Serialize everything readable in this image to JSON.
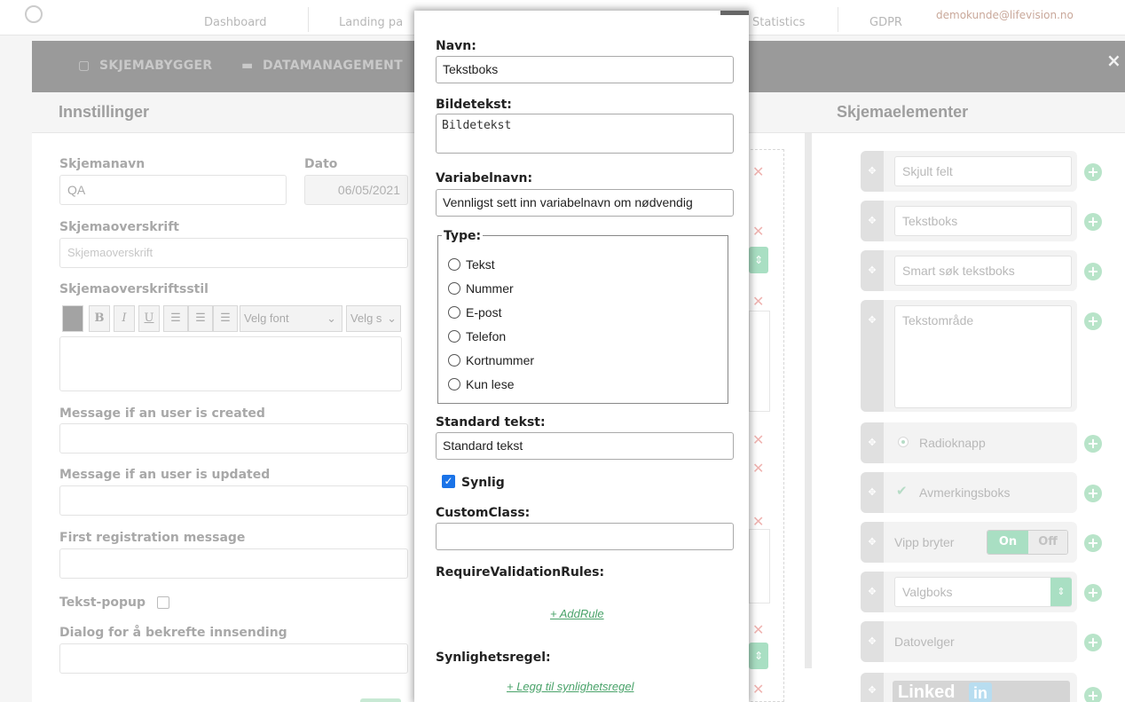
{
  "topnav": {
    "items": [
      "Dashboard",
      "Landing pa",
      "Statistics",
      "GDPR"
    ],
    "email": "demokunde@lifevision.no"
  },
  "modal": {
    "tabs": [
      "SKJEMABYGGER",
      "DATAMANAGEMENT"
    ],
    "close": "×"
  },
  "settings": {
    "title": "Innstillinger",
    "form_name_label": "Skjemanavn",
    "form_name_value": "QA",
    "date_label": "Dato",
    "date_value": "06/05/2021",
    "heading_label": "Skjemaoverskrift",
    "heading_placeholder": "Skjemaoverskrift",
    "heading_style_label": "Skjemaoverskriftsstil",
    "toolbar": {
      "bold": "B",
      "italic": "I",
      "underline": "U",
      "font_select": "Velg font",
      "size_select": "Velg s"
    },
    "msg_created_label": "Message if an user is created",
    "msg_updated_label": "Message if an user is updated",
    "first_reg_label": "First registration message",
    "popup_label": "Tekst-popup",
    "confirm_label": "Dialog for å bekrefte innsending"
  },
  "elements": {
    "title": "Skjemaelementer",
    "items": [
      {
        "label": "Skjult felt"
      },
      {
        "label": "Tekstboks"
      },
      {
        "label": "Smart søk tekstboks"
      },
      {
        "label": "Tekstområde"
      },
      {
        "label": "Radioknapp"
      },
      {
        "label": "Avmerkingsboks"
      },
      {
        "label": "Vipp bryter",
        "on": "On",
        "off": "Off"
      },
      {
        "label": "Valgboks"
      },
      {
        "label": "Datovelger"
      },
      {
        "label": "Linked"
      }
    ]
  },
  "popup": {
    "name_label": "Navn:",
    "name_value": "Tekstboks",
    "caption_label": "Bildetekst:",
    "caption_value": "Bildetekst",
    "varname_label": "Variabelnavn:",
    "varname_value": "Vennligst sett inn variabelnavn om nødvendig",
    "type_legend": "Type:",
    "types": [
      "Tekst",
      "Nummer",
      "E-post",
      "Telefon",
      "Kortnummer",
      "Kun lese"
    ],
    "default_label": "Standard tekst:",
    "default_value": "Standard tekst",
    "visible_label": "Synlig",
    "customclass_label": "CustomClass:",
    "customclass_value": "",
    "require_label": "RequireValidationRules:",
    "add_rule": "+ AddRule",
    "visibility_label": "Synlighetsregel:",
    "add_visibility": "+ Legg til synlighetsregel"
  }
}
